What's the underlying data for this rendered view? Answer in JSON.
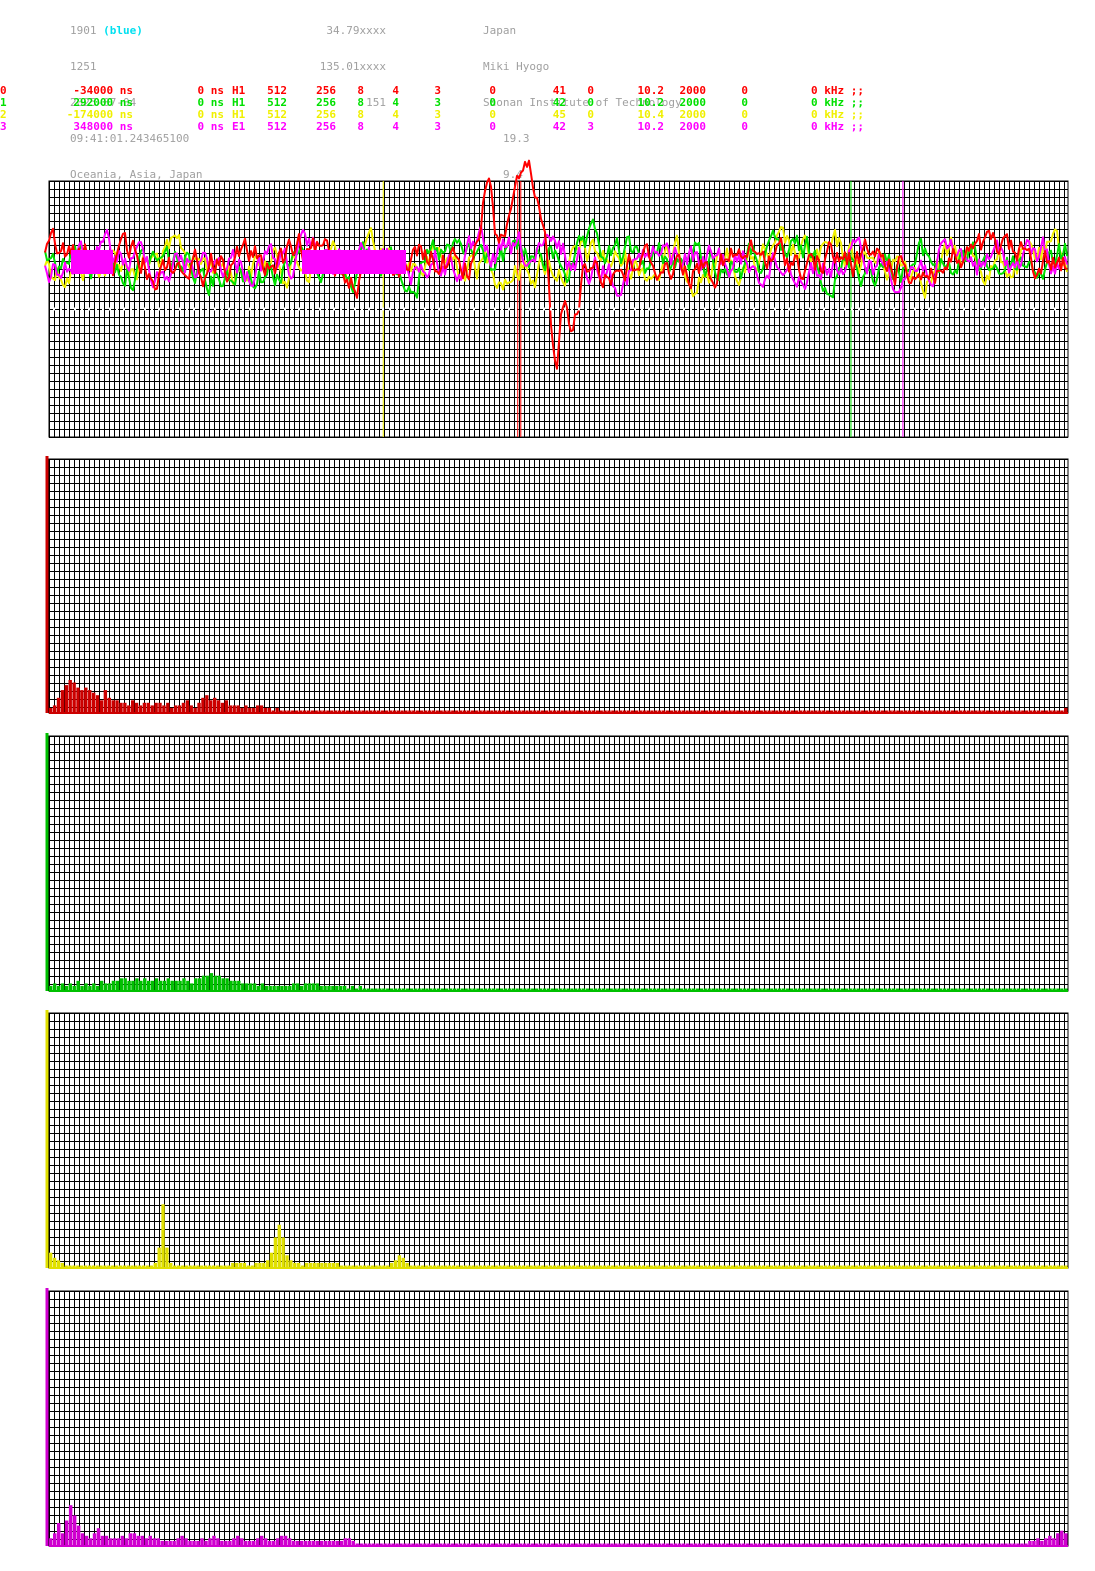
{
  "header": {
    "col1": {
      "id": "1901",
      "id_note": "(blue)",
      "line2": "1251",
      "date": "2025-07-04",
      "time": "09:41:01.243465100",
      "region": "Oceania, Asia, Japan"
    },
    "col2": {
      "lat": "34.79xxxx",
      "lon": "135.01xxxx",
      "alt": "151"
    },
    "col3": {
      "country": "Japan",
      "city": "Miki Hyogo",
      "institution": "Shonan Institute of Technology",
      "v1": "19.3",
      "v2": "9.4"
    }
  },
  "channels": [
    {
      "idx": "0",
      "offset": "-34000 ns",
      "delay": "0 ns",
      "ant": "H1",
      "n1": "512",
      "n2": "256",
      "n3": "8",
      "n4": "4",
      "n5": "3",
      "n6": "0",
      "n7": "41",
      "n8": "0",
      "freq": "10.2",
      "n9": "2000",
      "n10": "0",
      "khz": "0 kHz ;;",
      "color": "#ff0000"
    },
    {
      "idx": "1",
      "offset": "292000 ns",
      "delay": "0 ns",
      "ant": "H1",
      "n1": "512",
      "n2": "256",
      "n3": "8",
      "n4": "4",
      "n5": "3",
      "n6": "0",
      "n7": "42",
      "n8": "0",
      "freq": "10.2",
      "n9": "2000",
      "n10": "0",
      "khz": "0 kHz ;;",
      "color": "#00e000"
    },
    {
      "idx": "2",
      "offset": "-174000 ns",
      "delay": "0 ns",
      "ant": "H1",
      "n1": "512",
      "n2": "256",
      "n3": "8",
      "n4": "4",
      "n5": "3",
      "n6": "0",
      "n7": "45",
      "n8": "0",
      "freq": "10.4",
      "n9": "2000",
      "n10": "0",
      "khz": "0 kHz ;;",
      "color": "#f0f000"
    },
    {
      "idx": "3",
      "offset": "348000 ns",
      "delay": "0 ns",
      "ant": "E1",
      "n1": "512",
      "n2": "256",
      "n3": "8",
      "n4": "4",
      "n5": "3",
      "n6": "0",
      "n7": "42",
      "n8": "3",
      "freq": "10.2",
      "n9": "2000",
      "n10": "0",
      "khz": "0 kHz ;;",
      "color": "#ff00ff"
    }
  ],
  "chart_data": [
    {
      "type": "line",
      "series": [
        {
          "color": "#ff0000",
          "markers": [
            0.46,
            0.463
          ]
        },
        {
          "color": "#00e000",
          "markers": [
            0.787
          ]
        },
        {
          "color": "#f0f000",
          "markers": [
            0.328
          ]
        },
        {
          "color": "#ff00ff",
          "markers": [
            0.838
          ]
        }
      ],
      "grid": true
    },
    {
      "type": "bar",
      "color": "#cc0000",
      "values": [
        0.02,
        0.03,
        0.06,
        0.09,
        0.11,
        0.13,
        0.12,
        0.1,
        0.09,
        0.1,
        0.09,
        0.08,
        0.07,
        0.05,
        0.09,
        0.06,
        0.05,
        0.05,
        0.04,
        0.04,
        0.03,
        0.05,
        0.04,
        0.03,
        0.04,
        0.04,
        0.03,
        0.04,
        0.04,
        0.03,
        0.04,
        0.02,
        0.03,
        0.03,
        0.04,
        0.05,
        0.03,
        0.02,
        0.04,
        0.06,
        0.07,
        0.05,
        0.06,
        0.05,
        0.04,
        0.05,
        0.03,
        0.03,
        0.03,
        0.02,
        0.03,
        0.02,
        0.02,
        0.03,
        0.03,
        0.02,
        0.02,
        0.01,
        0.02,
        0.01,
        0.01,
        0.01,
        0.01,
        0.01,
        0.01,
        0.01,
        0.01,
        0.01,
        0.01,
        0.01,
        0.01,
        0.01,
        0.01,
        0.01,
        0.01,
        0.01,
        0.01,
        0.01,
        0.01,
        0.01,
        0.01,
        0.01,
        0.01,
        0.01,
        0.01,
        0.01,
        0.01,
        0.01,
        0.01,
        0.01,
        0.01,
        0.01,
        0.01,
        0.01,
        0.01,
        0.01,
        0.01,
        0.01,
        0.01,
        0.01,
        0.01,
        0.01,
        0.01,
        0.01,
        0.01,
        0.01,
        0.01,
        0.01,
        0.01,
        0.01,
        0.01,
        0.01,
        0.01,
        0.01,
        0.01,
        0.01,
        0.01,
        0.01,
        0.01,
        0.01,
        0.01,
        0.01,
        0.01,
        0.01,
        0.01,
        0.01,
        0.01,
        0.01,
        0.01,
        0.01,
        0.01,
        0.01,
        0.01,
        0.01,
        0.01,
        0.01,
        0.01,
        0.01,
        0.01,
        0.01,
        0.01,
        0.01,
        0.01,
        0.01,
        0.01,
        0.01,
        0.01,
        0.01,
        0.01,
        0.01,
        0.01,
        0.01,
        0.01,
        0.01,
        0.01,
        0.01,
        0.01,
        0.01,
        0.01,
        0.01,
        0.01,
        0.01,
        0.01,
        0.01,
        0.01,
        0.01,
        0.01,
        0.01,
        0.01,
        0.01,
        0.01,
        0.01,
        0.01,
        0.01,
        0.01,
        0.01,
        0.01,
        0.01,
        0.01,
        0.01,
        0.01,
        0.01,
        0.01,
        0.01,
        0.01,
        0.01,
        0.01,
        0.01,
        0.01,
        0.01,
        0.01,
        0.01,
        0.01,
        0.01,
        0.01,
        0.01,
        0.01,
        0.01,
        0.01,
        0.01,
        0.01,
        0.01,
        0.01,
        0.01,
        0.01,
        0.01,
        0.01,
        0.01,
        0.01,
        0.01,
        0.01,
        0.01,
        0.01,
        0.01,
        0.01,
        0.01,
        0.01,
        0.01,
        0.01,
        0.01,
        0.01,
        0.01,
        0.01,
        0.01,
        0.01,
        0.01,
        0.01,
        0.01,
        0.01,
        0.01,
        0.01,
        0.01,
        0.01,
        0.01,
        0.01,
        0.01,
        0.01,
        0.01,
        0.01,
        0.01,
        0.01,
        0.01,
        0.01,
        0.01,
        0.01,
        0.01,
        0.01,
        0.01,
        0.01,
        0.01,
        0.01,
        0.01,
        0.01,
        0.01,
        0.01,
        0.01,
        0.01,
        0.01,
        0.01,
        0.01,
        0.02
      ]
    },
    {
      "type": "bar",
      "color": "#00c000",
      "values": [
        0.02,
        0.03,
        0.02,
        0.03,
        0.02,
        0.03,
        0.02,
        0.04,
        0.02,
        0.03,
        0.02,
        0.03,
        0.02,
        0.04,
        0.03,
        0.03,
        0.04,
        0.04,
        0.05,
        0.05,
        0.04,
        0.04,
        0.05,
        0.04,
        0.05,
        0.04,
        0.04,
        0.05,
        0.04,
        0.04,
        0.05,
        0.04,
        0.04,
        0.04,
        0.05,
        0.04,
        0.03,
        0.05,
        0.05,
        0.06,
        0.06,
        0.07,
        0.06,
        0.06,
        0.05,
        0.05,
        0.04,
        0.04,
        0.04,
        0.03,
        0.03,
        0.03,
        0.03,
        0.02,
        0.03,
        0.02,
        0.02,
        0.02,
        0.02,
        0.02,
        0.02,
        0.02,
        0.03,
        0.03,
        0.02,
        0.03,
        0.03,
        0.03,
        0.03,
        0.02,
        0.02,
        0.02,
        0.02,
        0.02,
        0.02,
        0.02,
        0.01,
        0.02,
        0.01,
        0.02,
        0.01,
        0.01,
        0.01,
        0.01,
        0.01,
        0.01,
        0.01,
        0.01,
        0.01,
        0.01,
        0.01,
        0.01,
        0.01,
        0.01,
        0.01,
        0.01,
        0.01,
        0.01,
        0.01,
        0.01,
        0.01,
        0.01,
        0.01,
        0.01,
        0.01,
        0.01,
        0.01,
        0.01,
        0.01,
        0.01,
        0.01,
        0.01,
        0.01,
        0.01,
        0.01,
        0.01,
        0.01,
        0.01,
        0.01,
        0.01,
        0.01,
        0.01,
        0.01,
        0.01,
        0.01,
        0.01,
        0.01,
        0.01,
        0.01,
        0.01,
        0.01,
        0.01,
        0.01,
        0.01,
        0.01,
        0.01,
        0.01,
        0.01,
        0.01,
        0.01,
        0.01,
        0.01,
        0.01,
        0.01,
        0.01,
        0.01,
        0.01,
        0.01,
        0.01,
        0.01,
        0.01,
        0.01,
        0.01,
        0.01,
        0.01,
        0.01,
        0.01,
        0.01,
        0.01,
        0.01,
        0.01,
        0.01,
        0.01,
        0.01,
        0.01,
        0.01,
        0.01,
        0.01,
        0.01,
        0.01,
        0.01,
        0.01,
        0.01,
        0.01,
        0.01,
        0.01,
        0.01,
        0.01,
        0.01,
        0.01,
        0.01,
        0.01,
        0.01,
        0.01,
        0.01,
        0.01,
        0.01,
        0.01,
        0.01,
        0.01,
        0.01,
        0.01,
        0.01,
        0.01,
        0.01,
        0.01,
        0.01,
        0.01,
        0.01,
        0.01,
        0.01,
        0.01,
        0.01,
        0.01,
        0.01,
        0.01,
        0.01,
        0.01,
        0.01,
        0.01,
        0.01,
        0.01,
        0.01,
        0.01,
        0.01,
        0.01,
        0.01,
        0.01,
        0.01,
        0.01,
        0.01,
        0.01,
        0.01,
        0.01,
        0.01,
        0.01,
        0.01,
        0.01,
        0.01,
        0.01,
        0.01,
        0.01,
        0.01,
        0.01,
        0.01,
        0.01,
        0.01,
        0.01,
        0.01,
        0.01,
        0.01,
        0.01,
        0.01,
        0.01,
        0.01,
        0.01,
        0.01,
        0.01,
        0.01,
        0.01,
        0.01,
        0.01,
        0.01,
        0.01,
        0.01,
        0.01,
        0.01,
        0.01,
        0.01,
        0.01
      ]
    },
    {
      "type": "bar",
      "color": "#e0e000",
      "values": [
        0.06,
        0.04,
        0.03,
        0.02,
        0.01,
        0.01,
        0.01,
        0.01,
        0.01,
        0.01,
        0.01,
        0.01,
        0.01,
        0.01,
        0.01,
        0.01,
        0.01,
        0.01,
        0.01,
        0.01,
        0.01,
        0.01,
        0.01,
        0.01,
        0.01,
        0.01,
        0.01,
        0.02,
        0.08,
        0.25,
        0.08,
        0.02,
        0.01,
        0.01,
        0.01,
        0.01,
        0.01,
        0.01,
        0.01,
        0.01,
        0.01,
        0.01,
        0.01,
        0.01,
        0.01,
        0.01,
        0.01,
        0.02,
        0.02,
        0.02,
        0.02,
        0.01,
        0.01,
        0.02,
        0.02,
        0.02,
        0.03,
        0.06,
        0.12,
        0.17,
        0.12,
        0.05,
        0.03,
        0.02,
        0.02,
        0.01,
        0.02,
        0.02,
        0.02,
        0.02,
        0.02,
        0.02,
        0.02,
        0.02,
        0.02,
        0.01,
        0.01,
        0.01,
        0.01,
        0.01,
        0.01,
        0.01,
        0.01,
        0.01,
        0.01,
        0.01,
        0.01,
        0.01,
        0.02,
        0.03,
        0.05,
        0.04,
        0.02,
        0.01,
        0.01,
        0.01,
        0.01,
        0.01,
        0.01,
        0.01,
        0.01,
        0.01,
        0.01,
        0.01,
        0.01,
        0.01,
        0.01,
        0.01,
        0.01,
        0.01,
        0.01,
        0.01,
        0.01,
        0.01,
        0.01,
        0.01,
        0.01,
        0.01,
        0.01,
        0.01,
        0.01,
        0.01,
        0.01,
        0.01,
        0.01,
        0.01,
        0.01,
        0.01,
        0.01,
        0.01,
        0.01,
        0.01,
        0.01,
        0.01,
        0.01,
        0.01,
        0.01,
        0.01,
        0.01,
        0.01,
        0.01,
        0.01,
        0.01,
        0.01,
        0.01,
        0.01,
        0.01,
        0.01,
        0.01,
        0.01,
        0.01,
        0.01,
        0.01,
        0.01,
        0.01,
        0.01,
        0.01,
        0.01,
        0.01,
        0.01,
        0.01,
        0.01,
        0.01,
        0.01,
        0.01,
        0.01,
        0.01,
        0.01,
        0.01,
        0.01,
        0.01,
        0.01,
        0.01,
        0.01,
        0.01,
        0.01,
        0.01,
        0.01,
        0.01,
        0.01,
        0.01,
        0.01,
        0.01,
        0.01,
        0.01,
        0.01,
        0.01,
        0.01,
        0.01,
        0.01,
        0.01,
        0.01,
        0.01,
        0.01,
        0.01,
        0.01,
        0.01,
        0.01,
        0.01,
        0.01,
        0.01,
        0.01,
        0.01,
        0.01,
        0.01,
        0.01,
        0.01,
        0.01,
        0.01,
        0.01,
        0.01,
        0.01,
        0.01,
        0.01,
        0.01,
        0.01,
        0.01,
        0.01,
        0.01,
        0.01,
        0.01,
        0.01,
        0.01,
        0.01,
        0.01,
        0.01,
        0.01,
        0.01,
        0.01,
        0.01,
        0.01,
        0.01,
        0.01,
        0.01,
        0.01,
        0.01,
        0.01,
        0.01,
        0.01,
        0.01,
        0.01,
        0.01,
        0.01,
        0.01,
        0.01,
        0.01,
        0.01,
        0.01,
        0.01,
        0.01,
        0.01,
        0.01,
        0.01,
        0.01,
        0.01,
        0.01,
        0.01,
        0.01,
        0.01,
        0.01,
        0.01,
        0.01,
        0.01
      ]
    },
    {
      "type": "bar",
      "color": "#d000d0",
      "values": [
        0.03,
        0.05,
        0.09,
        0.05,
        0.1,
        0.16,
        0.12,
        0.08,
        0.05,
        0.04,
        0.03,
        0.05,
        0.07,
        0.04,
        0.04,
        0.03,
        0.03,
        0.03,
        0.04,
        0.03,
        0.05,
        0.05,
        0.04,
        0.04,
        0.03,
        0.04,
        0.03,
        0.03,
        0.02,
        0.02,
        0.02,
        0.02,
        0.03,
        0.04,
        0.03,
        0.02,
        0.02,
        0.02,
        0.03,
        0.02,
        0.03,
        0.04,
        0.03,
        0.02,
        0.02,
        0.02,
        0.03,
        0.04,
        0.03,
        0.02,
        0.02,
        0.02,
        0.03,
        0.04,
        0.03,
        0.02,
        0.02,
        0.03,
        0.04,
        0.04,
        0.03,
        0.02,
        0.02,
        0.02,
        0.02,
        0.02,
        0.02,
        0.02,
        0.02,
        0.02,
        0.02,
        0.02,
        0.02,
        0.02,
        0.03,
        0.03,
        0.02,
        0.01,
        0.01,
        0.01,
        0.01,
        0.01,
        0.01,
        0.01,
        0.01,
        0.01,
        0.01,
        0.01,
        0.01,
        0.01,
        0.01,
        0.01,
        0.01,
        0.01,
        0.01,
        0.01,
        0.01,
        0.01,
        0.01,
        0.01,
        0.01,
        0.01,
        0.01,
        0.01,
        0.01,
        0.01,
        0.01,
        0.01,
        0.01,
        0.01,
        0.01,
        0.01,
        0.01,
        0.01,
        0.01,
        0.01,
        0.01,
        0.01,
        0.01,
        0.01,
        0.01,
        0.01,
        0.01,
        0.01,
        0.01,
        0.01,
        0.01,
        0.01,
        0.01,
        0.01,
        0.01,
        0.01,
        0.01,
        0.01,
        0.01,
        0.01,
        0.01,
        0.01,
        0.01,
        0.01,
        0.01,
        0.01,
        0.01,
        0.01,
        0.01,
        0.01,
        0.01,
        0.01,
        0.01,
        0.01,
        0.01,
        0.01,
        0.01,
        0.01,
        0.01,
        0.01,
        0.01,
        0.01,
        0.01,
        0.01,
        0.01,
        0.01,
        0.01,
        0.01,
        0.01,
        0.01,
        0.01,
        0.01,
        0.01,
        0.01,
        0.01,
        0.01,
        0.01,
        0.01,
        0.01,
        0.01,
        0.01,
        0.01,
        0.01,
        0.01,
        0.01,
        0.01,
        0.01,
        0.01,
        0.01,
        0.01,
        0.01,
        0.01,
        0.01,
        0.01,
        0.01,
        0.01,
        0.01,
        0.01,
        0.01,
        0.01,
        0.01,
        0.01,
        0.01,
        0.01,
        0.01,
        0.01,
        0.01,
        0.01,
        0.01,
        0.01,
        0.01,
        0.01,
        0.01,
        0.01,
        0.01,
        0.01,
        0.01,
        0.01,
        0.01,
        0.01,
        0.01,
        0.01,
        0.01,
        0.01,
        0.01,
        0.01,
        0.01,
        0.01,
        0.01,
        0.01,
        0.01,
        0.01,
        0.01,
        0.01,
        0.01,
        0.01,
        0.01,
        0.01,
        0.01,
        0.01,
        0.01,
        0.01,
        0.01,
        0.01,
        0.01,
        0.01,
        0.01,
        0.01,
        0.01,
        0.01,
        0.02,
        0.02,
        0.03,
        0.02,
        0.03,
        0.04,
        0.03,
        0.05,
        0.06,
        0.05
      ]
    }
  ]
}
